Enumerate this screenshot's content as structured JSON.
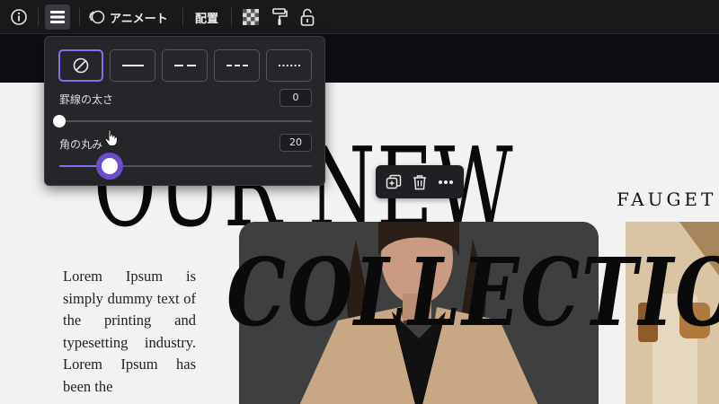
{
  "toolbar": {
    "animate_label": "アニメート",
    "arrange_label": "配置"
  },
  "popup": {
    "border_width_label": "罫線の太さ",
    "border_width_value": "0",
    "border_width_level": 0,
    "corner_radius_label": "角の丸み",
    "corner_radius_value": "20",
    "corner_radius_level": 0.2,
    "line_styles": [
      "none",
      "solid",
      "dashed",
      "short-dashed",
      "dotted"
    ],
    "selected_style": "none"
  },
  "canvas": {
    "title_line1": "OUR NEW",
    "title_line2": "COLLECTIO",
    "brand": "FAUGET",
    "body_text": "Lorem Ipsum is simply dummy text of the printing and typesetting industry. Lorem Ipsum has been the",
    "accent_color": "#8b6cf0"
  }
}
